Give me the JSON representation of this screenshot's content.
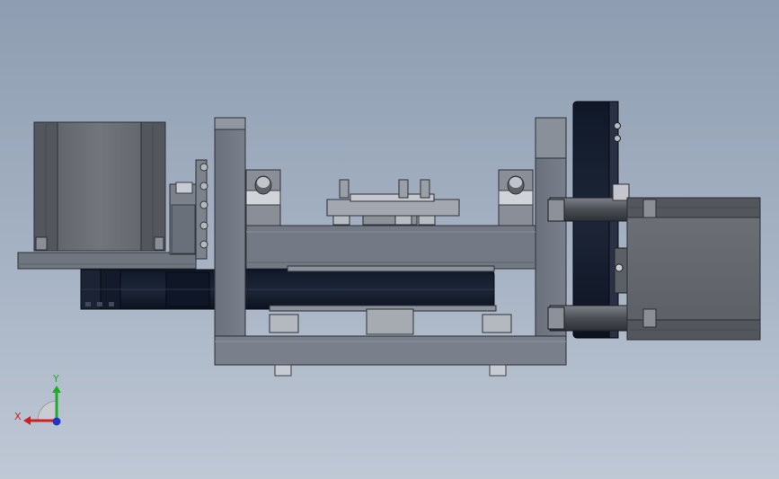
{
  "triad": {
    "x_label": "X",
    "y_label": "Y",
    "x_color": "#d11f1f",
    "y_color": "#1faa2a",
    "z_color": "#2233cc"
  },
  "colors": {
    "frame": "#6f7582",
    "frame_dark": "#4a4f59",
    "motor": "#686c72",
    "belt": "#141c2c",
    "metal_light": "#c9ccd2"
  },
  "icons": [
    "coordinate-triad-icon"
  ]
}
